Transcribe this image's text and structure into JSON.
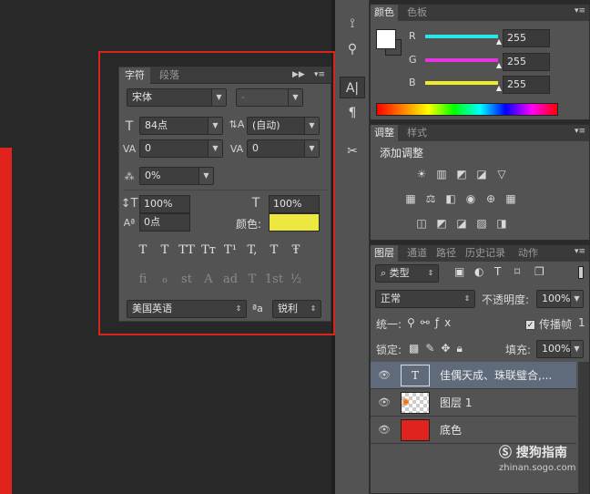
{
  "character": {
    "tabs": [
      "字符",
      "段落"
    ],
    "font_family": "宋体",
    "font_style": "-",
    "font_size": "84点",
    "leading": "(自动)",
    "kerning": "0",
    "tracking": "0",
    "scale_percent": "0%",
    "vertical_scale": "100%",
    "horizontal_scale": "100%",
    "baseline_shift": "0点",
    "color_label": "颜色:",
    "color_swatch": "#ece840",
    "style_buttons": [
      "T",
      "T",
      "TT",
      "Tт",
      "T¹",
      "T,",
      "T",
      "Ŧ"
    ],
    "opentype_buttons": [
      "fi",
      "ℴ",
      "st",
      "A",
      "ad",
      "T",
      "1st",
      "½"
    ],
    "language": "美国英语",
    "aa_icon": "ªa",
    "antialias": "锐利"
  },
  "color_panel": {
    "tabs": [
      "颜色",
      "色板"
    ],
    "fg_color": "#ffffff",
    "bg_color": "#4a4a4a",
    "channels": [
      {
        "label": "R",
        "value": "255",
        "color": "#29e7e7"
      },
      {
        "label": "G",
        "value": "255",
        "color": "#e435e2"
      },
      {
        "label": "B",
        "value": "255",
        "color": "#f0eb2b"
      }
    ]
  },
  "adjustments": {
    "tabs": [
      "调整",
      "样式"
    ],
    "title": "添加调整",
    "row1": [
      "☀",
      "▥",
      "◩",
      "◪",
      "▽"
    ],
    "row2": [
      "▦",
      "⚖",
      "◧",
      "◉",
      "⊕",
      "▦"
    ],
    "row3": [
      "◫",
      "◩",
      "◪",
      "▨",
      "◨"
    ]
  },
  "layers": {
    "tabs": [
      "图层",
      "通道",
      "路径",
      "历史记录",
      "动作"
    ],
    "filter_type": "类型",
    "filter_icons": [
      "▣",
      "◐",
      "T",
      "⌑",
      "❐"
    ],
    "blend_mode": "正常",
    "opacity_label": "不透明度:",
    "opacity_value": "100%",
    "unify_label": "统一:",
    "propagate_label": "传播帧",
    "propagate_count": "1",
    "lock_label": "锁定:",
    "fill_label": "填充:",
    "fill_value": "100%",
    "items": [
      {
        "name": "佳偶天成、珠联璧合,...",
        "type": "text",
        "selected": true
      },
      {
        "name": "图层 1",
        "type": "image"
      },
      {
        "name": "底色",
        "type": "fill",
        "color": "#e0231c"
      }
    ]
  },
  "watermark": {
    "brand": "搜狗指南",
    "url": "zhinan.sogo.com"
  }
}
